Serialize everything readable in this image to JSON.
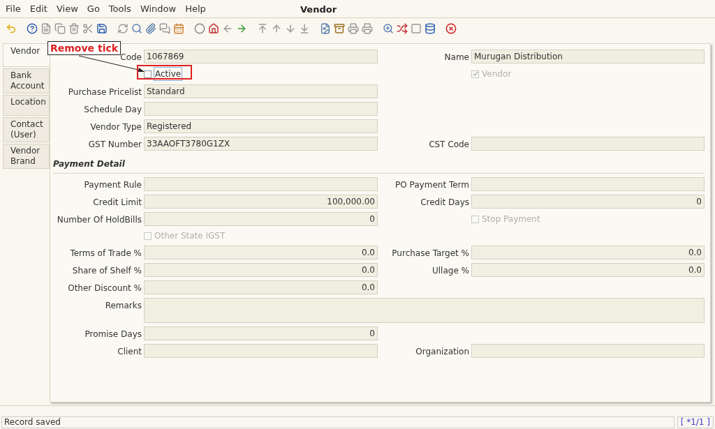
{
  "menu": [
    "File",
    "Edit",
    "View",
    "Go",
    "Tools",
    "Window",
    "Help"
  ],
  "window": {
    "title": "Vendor"
  },
  "tabs": [
    {
      "label": "Vendor",
      "selected": true
    },
    {
      "label": "Bank Account",
      "selected": false
    },
    {
      "label": "Location",
      "selected": false
    },
    {
      "label": "Contact (User)",
      "selected": false
    },
    {
      "label": "Vendor Brand",
      "selected": false
    }
  ],
  "rows": [
    {
      "left": {
        "kind": "field",
        "label": "Code",
        "value": "1067869"
      },
      "right": {
        "kind": "field",
        "label": "Name",
        "value": "Murugan Distribution"
      }
    },
    {
      "left": {
        "kind": "checkbox",
        "label": "Active",
        "checked": false,
        "disabled": false
      },
      "right": {
        "kind": "checkbox",
        "label": "Vendor",
        "checked": true,
        "disabled": true
      }
    },
    {
      "left": {
        "kind": "field",
        "label": "Purchase Pricelist",
        "value": "Standard"
      }
    },
    {
      "left": {
        "kind": "field",
        "label": "Schedule Day"
      }
    },
    {
      "left": {
        "kind": "field",
        "label": "Vendor Type",
        "value": "Registered"
      }
    },
    {
      "left": {
        "kind": "field",
        "label": "GST Number",
        "value": "33AAOFT3780G1ZX"
      },
      "right": {
        "kind": "field",
        "label": "CST Code"
      }
    },
    {
      "heading": "Payment Detail"
    },
    {
      "left": {
        "kind": "field",
        "label": "Payment Rule"
      },
      "right": {
        "kind": "field",
        "label": "PO Payment Term"
      }
    },
    {
      "left": {
        "kind": "number",
        "label": "Credit Limit",
        "value": "100,000.00"
      },
      "right": {
        "kind": "number",
        "label": "Credit Days",
        "value": "0"
      }
    },
    {
      "left": {
        "kind": "number",
        "label": "Number Of HoldBills",
        "value": "0"
      },
      "right": {
        "kind": "checkbox",
        "label": "Stop Payment",
        "checked": false,
        "disabled": true
      }
    },
    {
      "left": {
        "kind": "checkbox",
        "label": "Other State IGST",
        "checked": false,
        "disabled": true
      }
    },
    {
      "left": {
        "kind": "number",
        "label": "Terms of Trade %",
        "value": "0.0"
      },
      "right": {
        "kind": "number",
        "label": "Purchase Target %",
        "value": "0.0"
      }
    },
    {
      "left": {
        "kind": "number",
        "label": "Share of Shelf %",
        "value": "0.0"
      },
      "right": {
        "kind": "number",
        "label": "Ullage %",
        "value": "0.0"
      }
    },
    {
      "left": {
        "kind": "number",
        "label": "Other Discount %",
        "value": "0.0"
      }
    },
    {
      "left": {
        "kind": "textarea",
        "label": "Remarks"
      }
    },
    {
      "left": {
        "kind": "number",
        "label": "Promise Days",
        "value": "0"
      }
    },
    {
      "left": {
        "kind": "field",
        "label": "Client"
      },
      "right": {
        "kind": "field",
        "label": "Organization"
      }
    }
  ],
  "annotation": {
    "text": "Remove tick"
  },
  "status_bar": {
    "message": "Record saved",
    "record": "[ *1/1 ]"
  }
}
